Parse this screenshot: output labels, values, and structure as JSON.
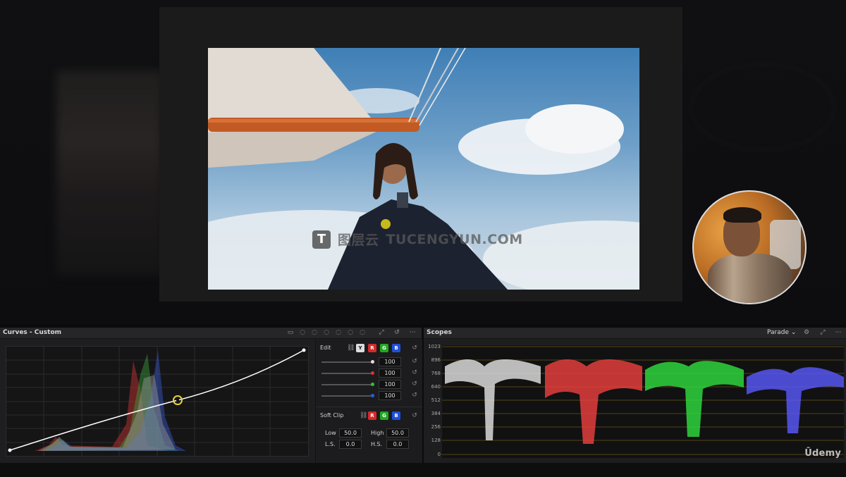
{
  "watermark": {
    "brand_cn": "图层云",
    "brand_en": "TUCENGYUN.COM",
    "icon_letter": "T"
  },
  "curves_panel": {
    "title": "Curves - Custom",
    "edit": {
      "label": "Edit",
      "channels": [
        "Y",
        "R",
        "G",
        "B"
      ],
      "values": [
        {
          "channel": "luma",
          "color": "#e0e0e0",
          "value": "100"
        },
        {
          "channel": "red",
          "color": "#e03030",
          "value": "100"
        },
        {
          "channel": "green",
          "color": "#2ec42e",
          "value": "100"
        },
        {
          "channel": "blue",
          "color": "#2a5ae8",
          "value": "100"
        }
      ]
    },
    "soft_clip": {
      "label": "Soft Clip",
      "channels": [
        "R",
        "G",
        "B"
      ],
      "low_label": "Low",
      "low_value": "50.0",
      "high_label": "High",
      "high_value": "50.0",
      "ls_label": "L.S.",
      "ls_value": "0.0",
      "hs_label": "H.S.",
      "hs_value": "0.0"
    }
  },
  "scopes_panel": {
    "title": "Scopes",
    "mode": "Parade",
    "scale": [
      "1023",
      "896",
      "768",
      "640",
      "512",
      "384",
      "256",
      "128",
      "0"
    ],
    "channel_colors": [
      "#e6e6e6",
      "#f04040",
      "#30e040",
      "#5a5aff"
    ]
  },
  "branding": {
    "udemy": "Ūdemy"
  },
  "accent_colors": {
    "red": "#d42a2a",
    "green": "#22a822",
    "blue": "#2050d8",
    "curve": "#ffffff",
    "point": "#e8d23a"
  }
}
